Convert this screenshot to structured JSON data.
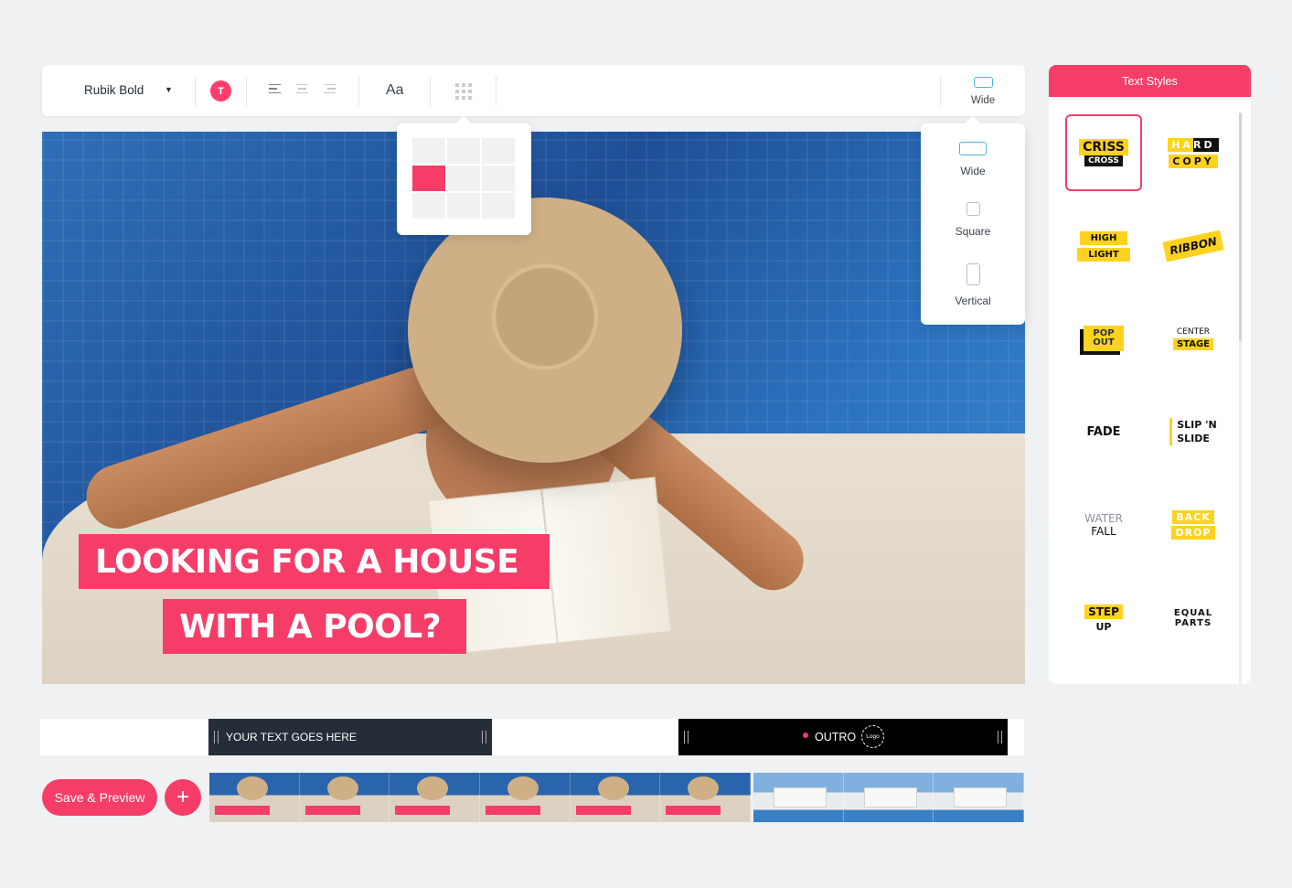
{
  "toolbar": {
    "font_name": "Rubik Bold",
    "color_letter": "T",
    "case_label": "Aa",
    "aspect_label": "Wide"
  },
  "canvas": {
    "caption_line1": "LOOKING FOR A HOUSE",
    "caption_line2": "WITH A POOL?"
  },
  "position_popup": {
    "active_cell": 3
  },
  "aspect_popup": {
    "options": [
      "Wide",
      "Square",
      "Vertical"
    ]
  },
  "text_styles": {
    "title": "Text Styles",
    "tiles": [
      {
        "lines": [
          "CRISS",
          "CROSS"
        ]
      },
      {
        "lines": [
          "HARD",
          "COPY"
        ]
      },
      {
        "lines": [
          "HIGH",
          "LIGHT"
        ]
      },
      {
        "lines": [
          "RIBBON"
        ]
      },
      {
        "lines": [
          "POP",
          "OUT"
        ]
      },
      {
        "lines": [
          "CENTER",
          "STAGE"
        ]
      },
      {
        "lines": [
          "FADE"
        ]
      },
      {
        "lines": [
          "SLIP 'N",
          "SLIDE"
        ]
      },
      {
        "lines": [
          "WATER",
          "FALL"
        ]
      },
      {
        "lines": [
          "BACK",
          "DROP"
        ]
      },
      {
        "lines": [
          "STEP",
          "UP"
        ]
      },
      {
        "lines": [
          "EQUAL",
          "PARTS"
        ]
      }
    ]
  },
  "timeline": {
    "text_clip": "YOUR TEXT GOES HERE",
    "outro_clip": "OUTRO",
    "logo_badge": "Logo",
    "save_button": "Save & Preview",
    "add_button": "+"
  },
  "colors": {
    "accent": "#f53d68",
    "background": "#eff1f2",
    "style_yellow": "#ffd21f",
    "aspect_icon": "#49b8d4"
  }
}
